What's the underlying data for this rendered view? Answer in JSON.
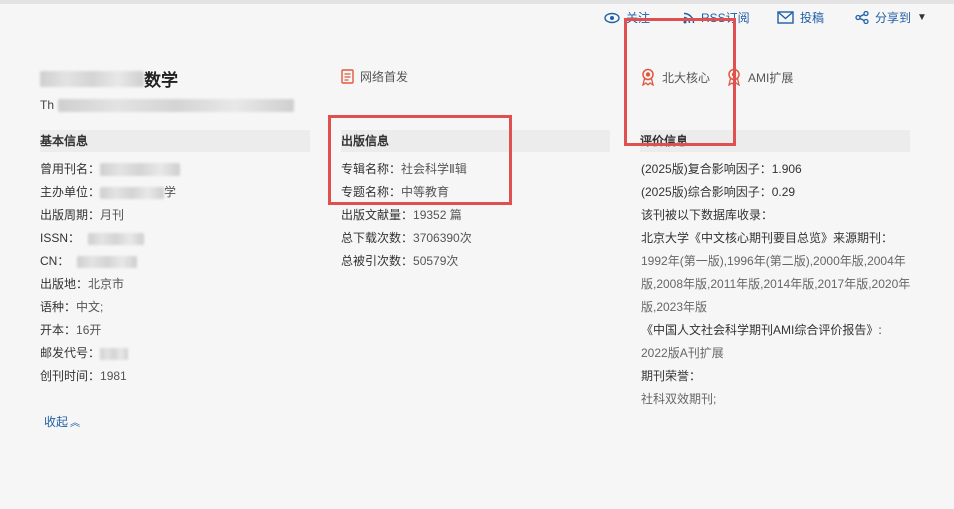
{
  "toolbar": {
    "follow_label": "关注",
    "rss_label": "RSS订阅",
    "submit_label": "投稿",
    "share_label": "分享到"
  },
  "header": {
    "title_visible": "数学",
    "subtitle_prefix": "Th"
  },
  "tags": {
    "online_first": "网络首发",
    "pku_core": "北大核心",
    "ami_ext": "AMI扩展"
  },
  "basic": {
    "heading": "基本信息",
    "rows": [
      {
        "label": "曾用刊名：",
        "value": ""
      },
      {
        "label": "主办单位：",
        "value": "学"
      },
      {
        "label": "出版周期：",
        "value": "月刊"
      },
      {
        "label": "ISSN：",
        "value": ""
      },
      {
        "label": "CN：",
        "value": ""
      },
      {
        "label": "出版地：",
        "value": "北京市"
      },
      {
        "label": "语种：",
        "value": "中文;"
      },
      {
        "label": "开本：",
        "value": "16开"
      },
      {
        "label": "邮发代号：",
        "value": ""
      },
      {
        "label": "创刊时间：",
        "value": "1981"
      }
    ],
    "collapse_label": "收起"
  },
  "publication": {
    "heading": "出版信息",
    "rows": [
      {
        "label": "专辑名称：",
        "value": "社会科学Ⅱ辑"
      },
      {
        "label": "专题名称：",
        "value": "中等教育"
      },
      {
        "label": "出版文献量：",
        "value": "19352 篇"
      },
      {
        "label": "总下载次数：",
        "value": "3706390次"
      },
      {
        "label": "总被引次数：",
        "value": "50579次"
      }
    ]
  },
  "evaluation": {
    "heading": "评价信息",
    "lines": [
      "(2025版)复合影响因子：1.906",
      "(2025版)综合影响因子：0.29",
      "该刊被以下数据库收录：",
      "北京大学《中文核心期刊要目总览》来源期刊：",
      "1992年(第一版),1996年(第二版),2000年版,2004年",
      "版,2008年版,2011年版,2014年版,2017年版,2020年",
      "版,2023年版",
      "《中国人文社会科学期刊AMI综合评价报告》:",
      "2022版A刊扩展",
      "期刊荣誉：",
      "社科双效期刊;"
    ]
  },
  "colors": {
    "link": "#1f5fa6",
    "highlight_box": "#e05050",
    "badge_red": "#e0583e",
    "background": "#f6f6f6"
  }
}
